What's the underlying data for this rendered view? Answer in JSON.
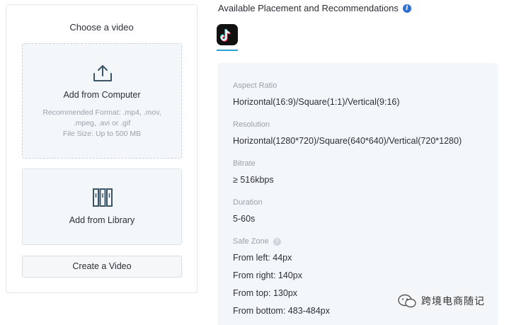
{
  "left_panel": {
    "title": "Choose a video",
    "upload": {
      "label": "Add from Computer",
      "hint": "Recommended Format: .mp4, .mov,\n.mpeg, .avi or .gif\nFile Size: Up to 500 MB"
    },
    "library": {
      "label": "Add from Library"
    },
    "create_button": "Create a Video"
  },
  "right_panel": {
    "heading": "Available Placement and Recommendations",
    "info_icon": "info-icon",
    "placement_icon": "tiktok-logo",
    "specs": {
      "aspect_ratio": {
        "label": "Aspect Ratio",
        "value": "Horizontal(16:9)/Square(1:1)/Vertical(9:16)"
      },
      "resolution": {
        "label": "Resolution",
        "value": "Horizontal(1280*720)/Square(640*640)/Vertical(720*1280)"
      },
      "bitrate": {
        "label": "Bitrate",
        "value": "≥ 516kbps"
      },
      "duration": {
        "label": "Duration",
        "value": "5-60s"
      },
      "safe_zone": {
        "label": "Safe Zone",
        "from_left": "From left: 44px",
        "from_right": "From right: 140px",
        "from_top": "From top: 130px",
        "from_bottom": "From bottom: 483-484px"
      }
    }
  },
  "watermark": {
    "text": "跨境电商随记"
  },
  "colors": {
    "accent": "#2a9fd6",
    "info": "#2f6fd0",
    "panel_bg": "#f4f7fa"
  }
}
